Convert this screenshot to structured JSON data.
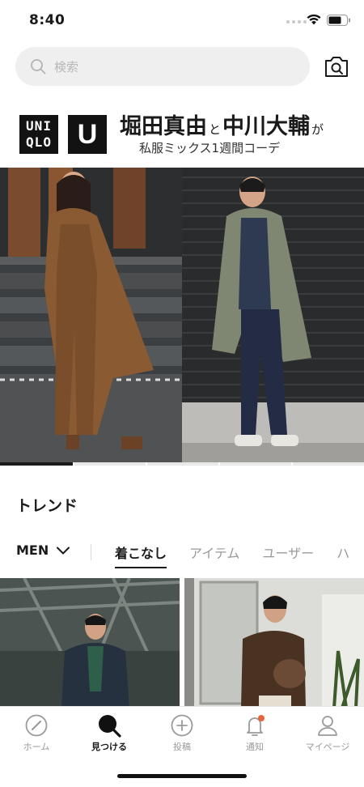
{
  "status_bar": {
    "time": "8:40"
  },
  "search": {
    "placeholder": "検索"
  },
  "banner": {
    "logo_text_line1": "UNI",
    "logo_text_line2": "QLO",
    "logo_u": "U",
    "name1": "堀田真由",
    "joiner": "と",
    "name2": "中川大輔",
    "particle": "が",
    "subtitle": "私服ミックス1週間コーデ"
  },
  "carousel": {
    "slides": 5,
    "active_index": 0
  },
  "trend": {
    "title": "トレンド",
    "gender": "MEN",
    "tabs": [
      {
        "label": "着こなし",
        "active": true
      },
      {
        "label": "アイテム",
        "active": false
      },
      {
        "label": "ユーザー",
        "active": false
      },
      {
        "label": "ハ",
        "active": false
      }
    ]
  },
  "bottom_nav": {
    "items": [
      {
        "label": "ホーム",
        "icon": "compass-icon",
        "active": false
      },
      {
        "label": "見つける",
        "icon": "search-icon",
        "active": true
      },
      {
        "label": "投稿",
        "icon": "plus-circle-icon",
        "active": false
      },
      {
        "label": "通知",
        "icon": "bell-icon",
        "active": false,
        "badge": true
      },
      {
        "label": "マイページ",
        "icon": "user-icon",
        "active": false
      }
    ]
  },
  "colors": {
    "accent": "#1a1a1a",
    "badge": "#e8643a",
    "search_bg": "#efefef"
  }
}
